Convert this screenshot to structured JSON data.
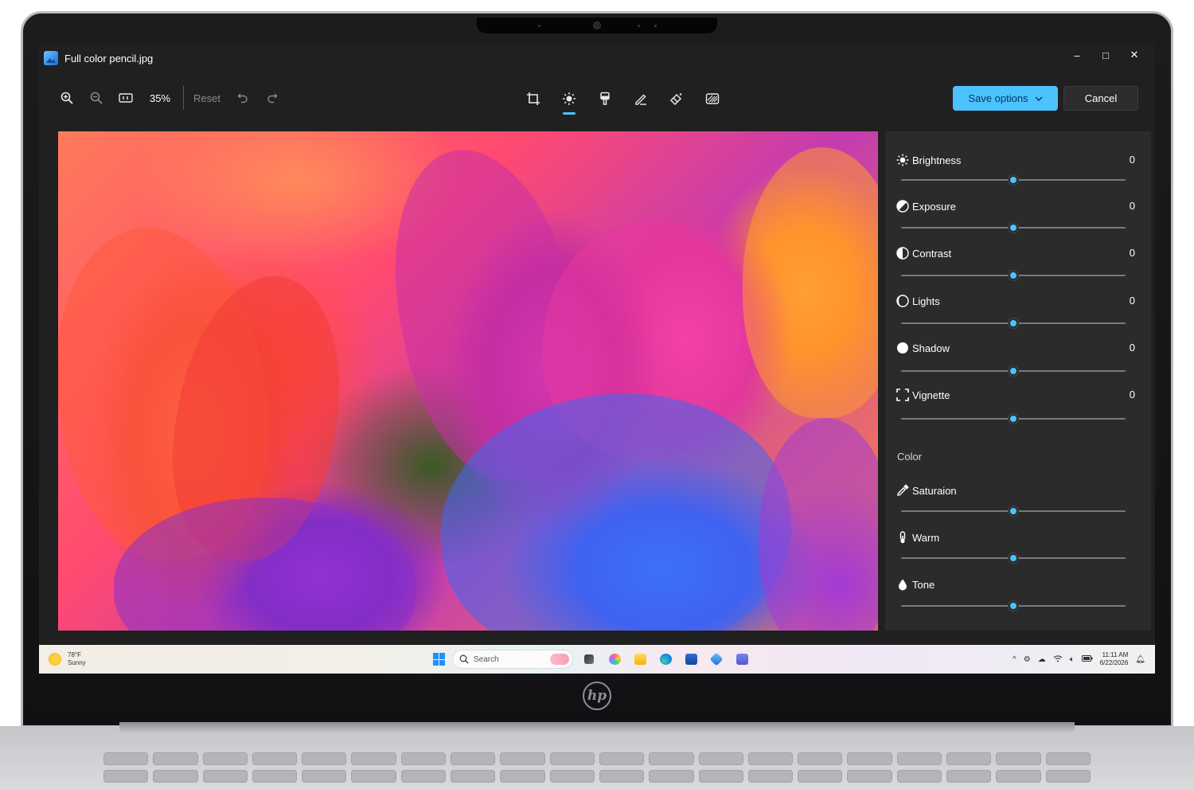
{
  "window": {
    "title": "Full color pencil.jpg",
    "controls": [
      "–",
      "□",
      "✕"
    ]
  },
  "toolbar": {
    "zoom_level": "35%",
    "reset_label": "Reset",
    "save_label": "Save options",
    "cancel_label": "Cancel",
    "active_tool": "adjust-tool",
    "accent_color": "#4cc2ff"
  },
  "adjustments": {
    "light": [
      {
        "label": "Brightness",
        "value": "0",
        "level": 0.5
      },
      {
        "label": "Exposure",
        "value": "0",
        "level": 0.5
      },
      {
        "label": "Contrast",
        "value": "0",
        "level": 0.5
      },
      {
        "label": "Lights",
        "value": "0",
        "level": 0.5
      },
      {
        "label": "Shadow",
        "value": "0",
        "level": 0.5
      },
      {
        "label": "Vignette",
        "value": "0",
        "level": 0.5
      }
    ],
    "color_section_label": "Color",
    "color": [
      {
        "label": "Saturaion",
        "level": 0.5
      },
      {
        "label": "Warm",
        "level": 0.5
      },
      {
        "label": "Tone",
        "level": 0.5
      }
    ]
  },
  "taskbar": {
    "weather_temp": "78°F",
    "weather_condition": "Sunny",
    "search_placeholder": "Search",
    "time": "11:11 AM",
    "date": "6/22/2026"
  },
  "device": {
    "logo_text": "hp"
  }
}
